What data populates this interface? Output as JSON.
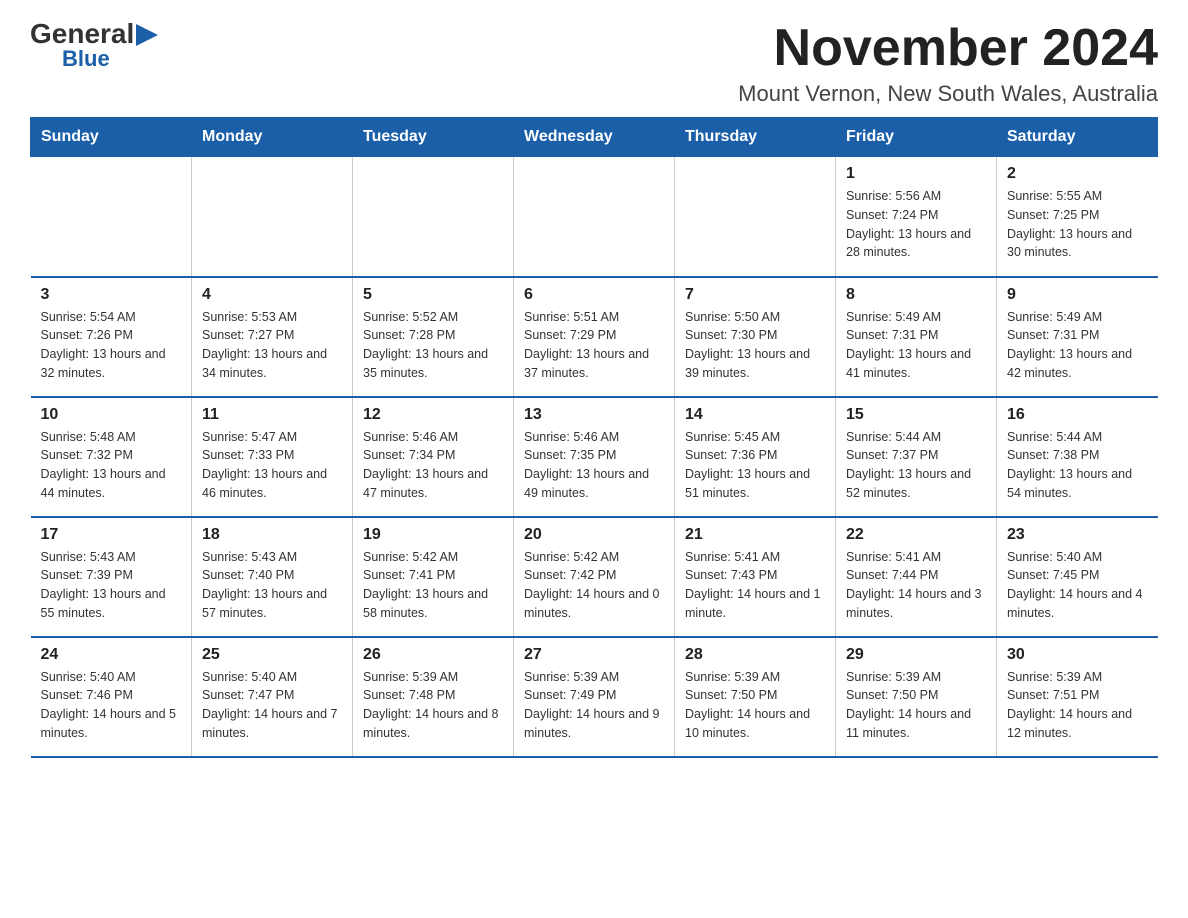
{
  "logo": {
    "general": "General",
    "triangle": "▶",
    "blue": "Blue"
  },
  "title": {
    "month": "November 2024",
    "location": "Mount Vernon, New South Wales, Australia"
  },
  "headers": [
    "Sunday",
    "Monday",
    "Tuesday",
    "Wednesday",
    "Thursday",
    "Friday",
    "Saturday"
  ],
  "weeks": [
    [
      {
        "day": "",
        "info": ""
      },
      {
        "day": "",
        "info": ""
      },
      {
        "day": "",
        "info": ""
      },
      {
        "day": "",
        "info": ""
      },
      {
        "day": "",
        "info": ""
      },
      {
        "day": "1",
        "info": "Sunrise: 5:56 AM\nSunset: 7:24 PM\nDaylight: 13 hours and 28 minutes."
      },
      {
        "day": "2",
        "info": "Sunrise: 5:55 AM\nSunset: 7:25 PM\nDaylight: 13 hours and 30 minutes."
      }
    ],
    [
      {
        "day": "3",
        "info": "Sunrise: 5:54 AM\nSunset: 7:26 PM\nDaylight: 13 hours and 32 minutes."
      },
      {
        "day": "4",
        "info": "Sunrise: 5:53 AM\nSunset: 7:27 PM\nDaylight: 13 hours and 34 minutes."
      },
      {
        "day": "5",
        "info": "Sunrise: 5:52 AM\nSunset: 7:28 PM\nDaylight: 13 hours and 35 minutes."
      },
      {
        "day": "6",
        "info": "Sunrise: 5:51 AM\nSunset: 7:29 PM\nDaylight: 13 hours and 37 minutes."
      },
      {
        "day": "7",
        "info": "Sunrise: 5:50 AM\nSunset: 7:30 PM\nDaylight: 13 hours and 39 minutes."
      },
      {
        "day": "8",
        "info": "Sunrise: 5:49 AM\nSunset: 7:31 PM\nDaylight: 13 hours and 41 minutes."
      },
      {
        "day": "9",
        "info": "Sunrise: 5:49 AM\nSunset: 7:31 PM\nDaylight: 13 hours and 42 minutes."
      }
    ],
    [
      {
        "day": "10",
        "info": "Sunrise: 5:48 AM\nSunset: 7:32 PM\nDaylight: 13 hours and 44 minutes."
      },
      {
        "day": "11",
        "info": "Sunrise: 5:47 AM\nSunset: 7:33 PM\nDaylight: 13 hours and 46 minutes."
      },
      {
        "day": "12",
        "info": "Sunrise: 5:46 AM\nSunset: 7:34 PM\nDaylight: 13 hours and 47 minutes."
      },
      {
        "day": "13",
        "info": "Sunrise: 5:46 AM\nSunset: 7:35 PM\nDaylight: 13 hours and 49 minutes."
      },
      {
        "day": "14",
        "info": "Sunrise: 5:45 AM\nSunset: 7:36 PM\nDaylight: 13 hours and 51 minutes."
      },
      {
        "day": "15",
        "info": "Sunrise: 5:44 AM\nSunset: 7:37 PM\nDaylight: 13 hours and 52 minutes."
      },
      {
        "day": "16",
        "info": "Sunrise: 5:44 AM\nSunset: 7:38 PM\nDaylight: 13 hours and 54 minutes."
      }
    ],
    [
      {
        "day": "17",
        "info": "Sunrise: 5:43 AM\nSunset: 7:39 PM\nDaylight: 13 hours and 55 minutes."
      },
      {
        "day": "18",
        "info": "Sunrise: 5:43 AM\nSunset: 7:40 PM\nDaylight: 13 hours and 57 minutes."
      },
      {
        "day": "19",
        "info": "Sunrise: 5:42 AM\nSunset: 7:41 PM\nDaylight: 13 hours and 58 minutes."
      },
      {
        "day": "20",
        "info": "Sunrise: 5:42 AM\nSunset: 7:42 PM\nDaylight: 14 hours and 0 minutes."
      },
      {
        "day": "21",
        "info": "Sunrise: 5:41 AM\nSunset: 7:43 PM\nDaylight: 14 hours and 1 minute."
      },
      {
        "day": "22",
        "info": "Sunrise: 5:41 AM\nSunset: 7:44 PM\nDaylight: 14 hours and 3 minutes."
      },
      {
        "day": "23",
        "info": "Sunrise: 5:40 AM\nSunset: 7:45 PM\nDaylight: 14 hours and 4 minutes."
      }
    ],
    [
      {
        "day": "24",
        "info": "Sunrise: 5:40 AM\nSunset: 7:46 PM\nDaylight: 14 hours and 5 minutes."
      },
      {
        "day": "25",
        "info": "Sunrise: 5:40 AM\nSunset: 7:47 PM\nDaylight: 14 hours and 7 minutes."
      },
      {
        "day": "26",
        "info": "Sunrise: 5:39 AM\nSunset: 7:48 PM\nDaylight: 14 hours and 8 minutes."
      },
      {
        "day": "27",
        "info": "Sunrise: 5:39 AM\nSunset: 7:49 PM\nDaylight: 14 hours and 9 minutes."
      },
      {
        "day": "28",
        "info": "Sunrise: 5:39 AM\nSunset: 7:50 PM\nDaylight: 14 hours and 10 minutes."
      },
      {
        "day": "29",
        "info": "Sunrise: 5:39 AM\nSunset: 7:50 PM\nDaylight: 14 hours and 11 minutes."
      },
      {
        "day": "30",
        "info": "Sunrise: 5:39 AM\nSunset: 7:51 PM\nDaylight: 14 hours and 12 minutes."
      }
    ]
  ]
}
